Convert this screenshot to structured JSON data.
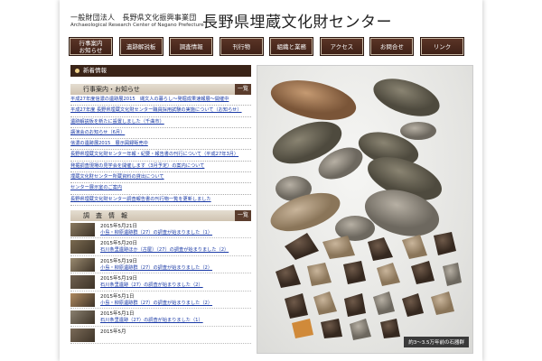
{
  "header": {
    "org_small": "一般財団法人　長野県文化振興事業団",
    "org_en": "Archaeological Research Center of Nagano Prefecture",
    "org_main": "長野県埋蔵文化財センター"
  },
  "nav": [
    {
      "label": "行事案内\nお知らせ"
    },
    {
      "label": "遺跡解説板"
    },
    {
      "label": "調査情報"
    },
    {
      "label": "刊行物"
    },
    {
      "label": "組織と業務"
    },
    {
      "label": "アクセス"
    },
    {
      "label": "お問合せ"
    },
    {
      "label": "リンク"
    }
  ],
  "new_info_label": "新着情報",
  "events": {
    "heading": "行事案内・お知らせ",
    "more": "一覧",
    "items": [
      "平成27年度信濃の遺跡展2015　縄文人の暮らし〜発掘成果速報展〜開催中",
      "平成27年度 長野県埋蔵文化財センター職員採用試験の実施について（お知らせ）",
      "遺跡解説板を新たに設置しました（千曲市）",
      "講演会のお知らせ（6月）",
      "信濃の遺跡展2015　展示図録販売中",
      "長野県埋蔵文化財センター年報・紀要・報告書の刊行について（平成27年3月）",
      "発掘調査現場の見学会を開催します（3月予定）の案内について",
      "埋蔵文化財センター所蔵資料の貸出について",
      "センター展示室のご案内",
      "長野県埋蔵文化財センター調査報告書の刊行物一覧を更新しました"
    ]
  },
  "reports": {
    "heading": "調　査　情　報",
    "more": "一覧",
    "items": [
      {
        "date": "2015年5月21日",
        "title": "小島・柳原遺跡群（27）の調査が始まりました（1）"
      },
      {
        "date": "2015年5月20日",
        "title": "石川条里遺跡ほか（古屋）（27）の調査が始まりました（2）"
      },
      {
        "date": "2015年5月19日",
        "title": "小島・柳原遺跡群（27）の調査が始まりました（2）"
      },
      {
        "date": "2015年5月19日",
        "title": "石川条里遺跡（27）の調査が始まりました（2）"
      },
      {
        "date": "2015年5月1日",
        "title": "小島・柳原遺跡群（27）の調査が始まりました（2）"
      },
      {
        "date": "2015年5月1日",
        "title": "石川条里遺跡（27）の調査が始まりました（1）"
      },
      {
        "date": "2015年5月",
        "title": ""
      }
    ]
  },
  "hero": {
    "caption": "約3〜3.5万年前の石器群"
  },
  "colors": {
    "nav_bg": "#4a2a1e",
    "link": "#1a3aa6",
    "bar_dark": "#3a2418"
  }
}
